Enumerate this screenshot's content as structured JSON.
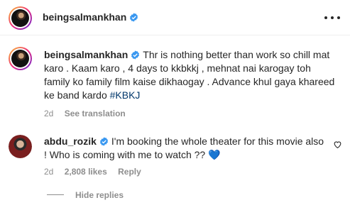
{
  "header": {
    "username": "beingsalmankhan"
  },
  "caption": {
    "username": "beingsalmankhan",
    "text": "Thr is nothing better than work so chill mat karo . Kaam karo , 4 days to kkbkkj , mehnat nai karogay toh family ko family film kaise dikhaogay . Advance khul gaya khareed ke band kardo ",
    "hashtag": "#KBKJ",
    "time": "2d",
    "see_translation": "See translation"
  },
  "reply": {
    "username": "abdu_rozik",
    "text": "I'm booking the whole theater for this movie also ! Who is coming with me to watch ?? ",
    "emoji": "💙",
    "time": "2d",
    "likes": "2,808 likes",
    "reply_label": "Reply"
  },
  "hide_replies": "Hide replies",
  "colors": {
    "verified": "#3897f0",
    "hashtag": "#00376b",
    "muted": "#8e8e8e",
    "text": "#262626"
  },
  "icons": [
    "verified-badge-icon",
    "more-options-icon",
    "heart-icon"
  ]
}
